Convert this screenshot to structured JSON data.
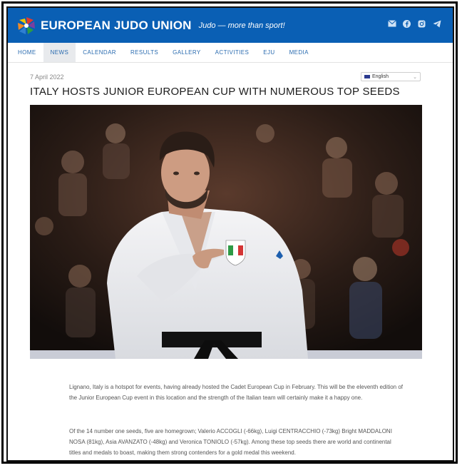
{
  "header": {
    "brand": "EUROPEAN JUDO UNION",
    "tagline": "Judo — more than sport!",
    "social_icons": [
      "mail-icon",
      "facebook-icon",
      "instagram-icon",
      "telegram-icon"
    ]
  },
  "nav": {
    "items": [
      {
        "label": "HOME",
        "active": false
      },
      {
        "label": "NEWS",
        "active": true
      },
      {
        "label": "CALENDAR",
        "active": false
      },
      {
        "label": "RESULTS",
        "active": false
      },
      {
        "label": "GALLERY",
        "active": false
      },
      {
        "label": "ACTIVITIES",
        "active": false
      },
      {
        "label": "EJU",
        "active": false
      },
      {
        "label": "MEDIA",
        "active": false
      }
    ]
  },
  "article": {
    "date": "7 April 2022",
    "language": "English",
    "title": "ITALY HOSTS JUNIOR EUROPEAN CUP WITH NUMEROUS TOP SEEDS",
    "paragraphs": [
      "Lignano, Italy is a hotspot for events, having already hosted the Cadet European Cup in February. This will be the eleventh edition of the Junior European Cup event in this location and the strength of the Italian team will certainly make it a happy one.",
      "Of the 14 number one seeds, five are homegrown; Valerio ACCOGLI (-66kg), Luigi CENTRACCHIO (-73kg) Bright MADDALONI NOSA (81kg), Asia AVANZATO (-48kg) and Veronica TONIOLO (-57kg). Among these top seeds there are world and continental titles and medals to boast, making them strong contenders for a gold medal this weekend."
    ]
  },
  "colors": {
    "header_blue": "#0a5fb4",
    "nav_link": "#2b6cb0",
    "nav_active_bg": "#e8eaed"
  }
}
